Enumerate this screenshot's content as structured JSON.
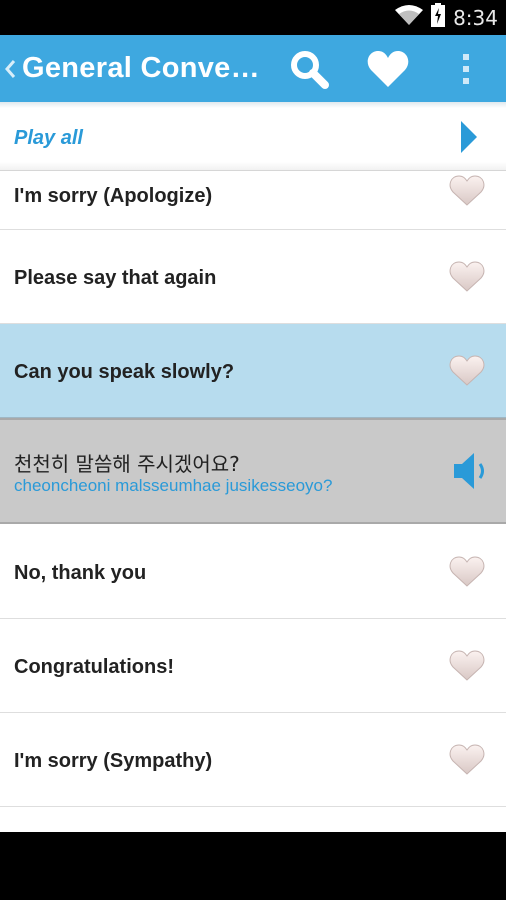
{
  "status": {
    "time": "8:34"
  },
  "header": {
    "title": "General Conve…"
  },
  "play_all": {
    "label": "Play all"
  },
  "phrases": [
    {
      "text": "I'm sorry (Apologize)"
    },
    {
      "text": "Please say that again"
    },
    {
      "text": "Can you speak slowly?"
    },
    {
      "text": "No, thank you"
    },
    {
      "text": "Congratulations!"
    },
    {
      "text": "I'm sorry (Sympathy)"
    }
  ],
  "translation": {
    "korean": "천천히 말씀해 주시겠어요?",
    "romanization": "cheoncheoni malsseumhae jusikesseoyo?"
  },
  "colors": {
    "accent": "#3ea8e0",
    "selected": "#b7dcee",
    "link": "#2a9ad8"
  },
  "icons": [
    "wifi-icon",
    "battery-icon",
    "back-chevron-icon",
    "search-icon",
    "favorites-heart-icon",
    "overflow-menu-icon",
    "play-icon",
    "heart-icon",
    "speaker-icon"
  ]
}
